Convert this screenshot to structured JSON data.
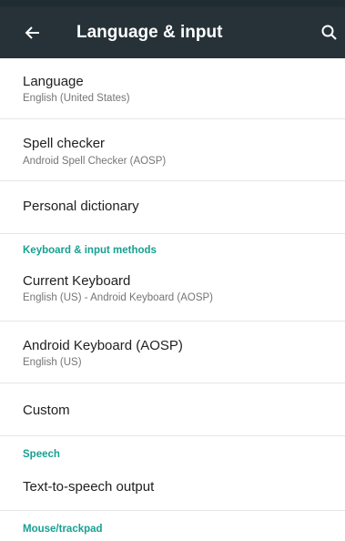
{
  "app_bar": {
    "title": "Language & input",
    "back_icon": "arrow-back-icon",
    "search_icon": "search-icon",
    "background": "#263238"
  },
  "accent_color": "#17a093",
  "items": [
    {
      "title": "Language",
      "summary": "English (United States)"
    },
    {
      "title": "Spell checker",
      "summary": "Android Spell Checker (AOSP)"
    },
    {
      "title": "Personal dictionary"
    },
    {
      "category": "Keyboard & input methods"
    },
    {
      "title": "Current Keyboard",
      "summary": "English (US) - Android Keyboard (AOSP)"
    },
    {
      "title": "Android Keyboard (AOSP)",
      "summary": "English (US)"
    },
    {
      "title": "Custom"
    },
    {
      "category": "Speech"
    },
    {
      "title": "Text-to-speech output"
    },
    {
      "category": "Mouse/trackpad"
    }
  ]
}
